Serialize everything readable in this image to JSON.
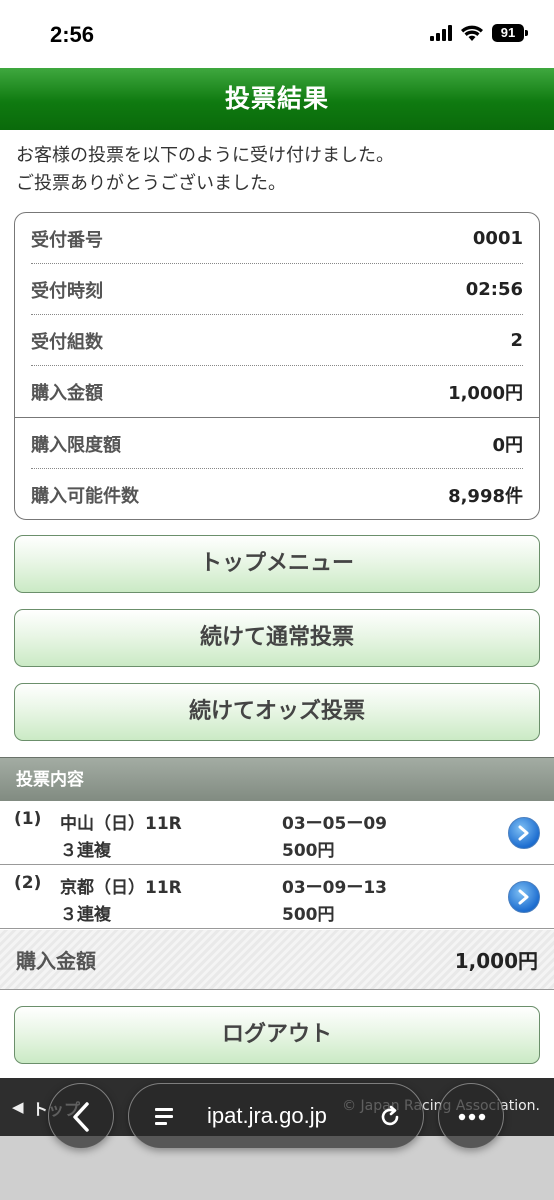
{
  "status": {
    "time": "2:56",
    "battery": "91"
  },
  "header": {
    "title": "投票結果"
  },
  "message": {
    "line1": "お客様の投票を以下のように受け付けました。",
    "line2": "ご投票ありがとうございました。"
  },
  "receipt": {
    "rows": [
      {
        "label": "受付番号",
        "value": "0001"
      },
      {
        "label": "受付時刻",
        "value": "02:56"
      },
      {
        "label": "受付組数",
        "value": "2"
      },
      {
        "label": "購入金額",
        "value": "1,000円"
      },
      {
        "label": "購入限度額",
        "value": "0円"
      },
      {
        "label": "購入可能件数",
        "value": "8,998件"
      }
    ]
  },
  "buttons": {
    "top_menu": "トップメニュー",
    "continue_normal": "続けて通常投票",
    "continue_odds": "続けてオッズ投票",
    "logout": "ログアウト"
  },
  "bets": {
    "section_title": "投票内容",
    "items": [
      {
        "index": "(1)",
        "race": "中山（日）11R",
        "type": "３連複",
        "combo": "03ー05ー09",
        "amount": "500円"
      },
      {
        "index": "(2)",
        "race": "京都（日）11R",
        "type": "３連複",
        "combo": "03ー09ー13",
        "amount": "500円"
      }
    ],
    "total_label": "購入金額",
    "total_value": "1,000円"
  },
  "footer": {
    "left_text": "トップ",
    "copyright": "© Japan Racing Association."
  },
  "browser": {
    "url": "ipat.jra.go.jp"
  },
  "icons": {
    "back": "chevron-left-icon",
    "tabs": "tabs-icon",
    "reload": "reload-icon",
    "more": "ellipsis-icon",
    "detail": "chevron-right-icon"
  },
  "colors": {
    "header_green": "#0f7a10",
    "button_green": "#cbeac5",
    "detail_blue": "#1e6ed0"
  }
}
